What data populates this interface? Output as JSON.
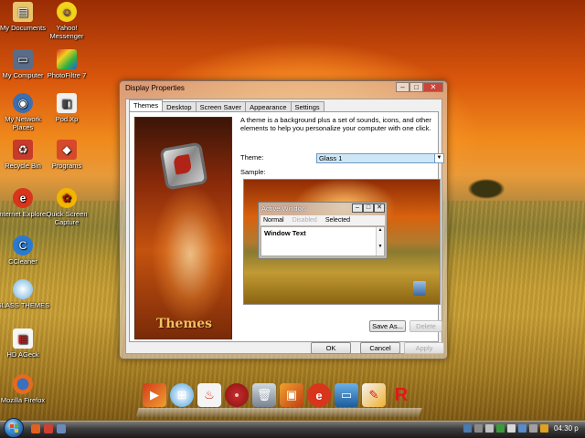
{
  "desktop": {
    "icons": [
      {
        "label": "My Documents",
        "icon": "folder-documents-icon"
      },
      {
        "label": "Yahoo! Messenger",
        "icon": "yahoo-messenger-icon"
      },
      {
        "label": "My Computer",
        "icon": "my-computer-icon"
      },
      {
        "label": "PhotoFiltre 7",
        "icon": "photofiltre-icon"
      },
      {
        "label": "My Network Places",
        "icon": "network-places-icon"
      },
      {
        "label": "Pod.Xp",
        "icon": "pod-xp-icon"
      },
      {
        "label": "Recycle Bin",
        "icon": "recycle-bin-icon"
      },
      {
        "label": "Programs",
        "icon": "programs-icon"
      },
      {
        "label": "Internet Explorer",
        "icon": "internet-explorer-icon"
      },
      {
        "label": "Quick Screen Capture",
        "icon": "screen-capture-icon"
      },
      {
        "label": "CCleaner",
        "icon": "ccleaner-icon"
      },
      {
        "label": "GLASS THEMES",
        "icon": "glass-themes-icon"
      },
      {
        "label": "HD AGeck",
        "icon": "hd-ageck-icon"
      },
      {
        "label": "Mozilla Firefox",
        "icon": "firefox-icon"
      }
    ]
  },
  "dialog": {
    "title": "Display Properties",
    "title_buttons": {
      "minimize": "–",
      "maximize": "□",
      "close": "✕"
    },
    "tabs": [
      "Themes",
      "Desktop",
      "Screen Saver",
      "Appearance",
      "Settings"
    ],
    "active_tab": "Themes",
    "art_title": "Themes",
    "description": "A theme is a background plus a set of sounds, icons, and other elements to help you personalize your computer with one click.",
    "theme_label": "Theme:",
    "theme_value": "Glass 1",
    "sample_label": "Sample:",
    "sample": {
      "window_title": "Active Window",
      "window_buttons": [
        "–",
        "□",
        "✕"
      ],
      "menu": {
        "normal": "Normal",
        "disabled": "Disabled",
        "selected": "Selected"
      },
      "window_text": "Window Text"
    },
    "buttons": {
      "save_as": "Save As...",
      "delete": "Delete",
      "ok": "OK",
      "cancel": "Cancel",
      "apply": "Apply"
    }
  },
  "dock": {
    "icons": [
      "media-player-icon",
      "windows-logo-icon",
      "java-icon",
      "disc-icon",
      "recycle-bin-icon",
      "photo-icon",
      "internet-explorer-icon",
      "display-icon",
      "paint-icon",
      "r-app-icon"
    ]
  },
  "taskbar": {
    "clock": "04:30 p"
  }
}
